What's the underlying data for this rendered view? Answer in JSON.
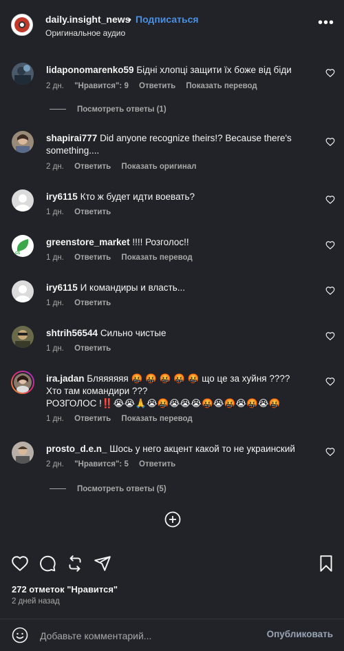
{
  "header": {
    "username": "daily.insight_news",
    "dot": "•",
    "follow": "Подписаться",
    "audio": "Оригинальное аудио",
    "more": "•••"
  },
  "comments": [
    {
      "user": "lidaponomarenko59",
      "text": "Бідні хлопці защити їх боже від біди",
      "time": "2 дн.",
      "likes": "\"Нравится\": 9",
      "reply": "Ответить",
      "extra": "Показать перевод",
      "replies": "Посмотреть ответы (1)"
    },
    {
      "user": "shapirai777",
      "text": "Did anyone recognize theirs!? Because there's something....",
      "time": "2 дн.",
      "reply": "Ответить",
      "extra": "Показать оригинал"
    },
    {
      "user": "iry6115",
      "text": "Кто ж будет идти воевать?",
      "time": "1 дн.",
      "reply": "Ответить"
    },
    {
      "user": "greenstore_market",
      "text": "!!!! Розголос!!",
      "time": "1 дн.",
      "reply": "Ответить",
      "extra": "Показать перевод"
    },
    {
      "user": "iry6115",
      "text": "И командиры и власть...",
      "time": "1 дн.",
      "reply": "Ответить"
    },
    {
      "user": "shtrih56544",
      "text": "Сильно чистые",
      "time": "1 дн.",
      "reply": "Ответить"
    },
    {
      "user": "ira.jadan",
      "text": "Бляяяяяя 🤬 🤬 🤬 🤬 🤬 що це за хуйня ????",
      "line2": "Хто там командири ???",
      "line3": "РОЗГОЛОС !‼️😭😭🙏😭🤬😭😭😭🤬😭🤬😭🤬😭🤬",
      "time": "1 дн.",
      "reply": "Ответить",
      "extra": "Показать перевод"
    },
    {
      "user": "prosto_d.e.n_",
      "text": "Шось у него акцент какой то не украинский",
      "time": "2 дн.",
      "likes": "\"Нравится\": 5",
      "reply": "Ответить",
      "replies": "Посмотреть ответы (5)"
    }
  ],
  "footer": {
    "likes": "272 отметок \"Нравится\"",
    "posted": "2 дней назад",
    "placeholder": "Добавьте комментарий...",
    "publish": "Опубликовать"
  }
}
